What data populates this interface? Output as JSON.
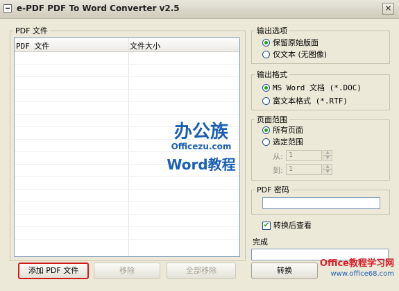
{
  "window": {
    "title": "e-PDF PDF To Word Converter v2.5",
    "close_glyph": "✕"
  },
  "file_group": {
    "label": "PDF 文件",
    "columns": [
      "PDF 文件",
      "文件大小"
    ],
    "rows": []
  },
  "output_options": {
    "label": "输出选项",
    "items": [
      {
        "label": "保留原始版面",
        "selected": true
      },
      {
        "label": "仅文本 (无图像)",
        "selected": false
      }
    ]
  },
  "output_format": {
    "label": "输出格式",
    "items": [
      {
        "label": "MS Word 文档 (*.DOC)",
        "selected": true
      },
      {
        "label": "富文本格式 (*.RTF)",
        "selected": false
      }
    ]
  },
  "page_range": {
    "label": "页面范围",
    "items": [
      {
        "label": "所有页面",
        "selected": true
      },
      {
        "label": "选定范围",
        "selected": false
      }
    ],
    "from_label": "从:",
    "from_value": "1",
    "to_label": "到:",
    "to_value": "1"
  },
  "pdf_password": {
    "label": "PDF 密码",
    "value": ""
  },
  "view_after": {
    "label": "转换后查看",
    "checked": true
  },
  "status": {
    "label": "完成",
    "value": ""
  },
  "buttons": {
    "add": "添加 PDF 文件",
    "remove": "移除",
    "remove_all": "全部移除",
    "convert": "转换"
  },
  "watermarks": {
    "brand1": "办公族",
    "brand1_url": "Officezu.com",
    "brand1_tag": "Word教程",
    "brand2": "Office教程学习网",
    "brand2_url": "www.office68.com"
  },
  "colors": {
    "radio_selected": "#21a121",
    "focus_border": "#cf1c1c",
    "watermark_blue": "#1a5fb4"
  }
}
